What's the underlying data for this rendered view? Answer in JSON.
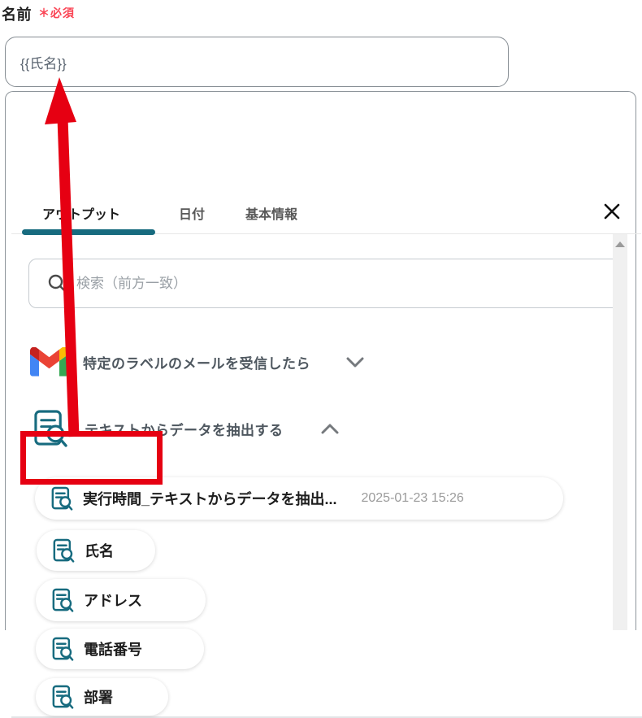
{
  "field": {
    "label": "名前",
    "required_badge": "＊必須",
    "value": "{{氏名}}"
  },
  "panel": {
    "tabs": [
      {
        "label": "アウトプット",
        "active": true
      },
      {
        "label": "日付",
        "active": false
      },
      {
        "label": "基本情報",
        "active": false
      }
    ],
    "search": {
      "placeholder": "検索（前方一致）"
    },
    "groups": [
      {
        "icon": "gmail-icon",
        "label": "特定のラベルのメールを受信したら",
        "state": "collapsed"
      },
      {
        "icon": "extract-text-icon",
        "label": "テキストからデータを抽出する",
        "state": "expanded"
      }
    ],
    "outputs": [
      {
        "label": "実行時間_テキストからデータを抽出...",
        "timestamp": "2025-01-23 15:26",
        "highlighted": false
      },
      {
        "label": "氏名",
        "highlighted": true
      },
      {
        "label": "アドレス",
        "highlighted": false
      },
      {
        "label": "電話番号",
        "highlighted": false
      },
      {
        "label": "部署",
        "highlighted": false
      }
    ]
  },
  "colors": {
    "accent_teal": "#176b7f",
    "annotation_red": "#e60012",
    "required_red": "#fa4555"
  }
}
